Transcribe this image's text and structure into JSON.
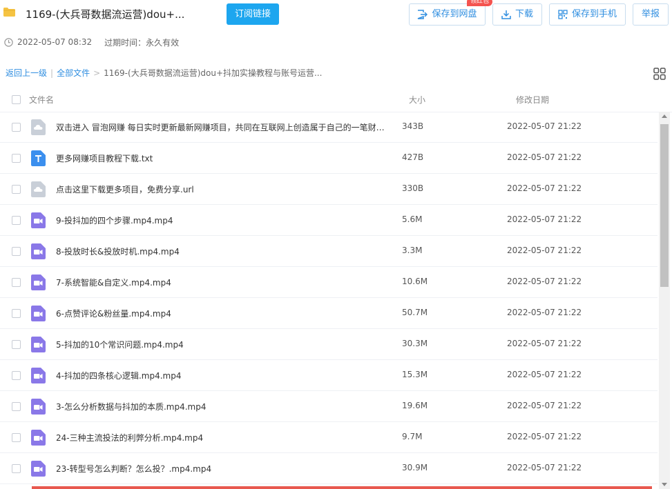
{
  "header": {
    "title": "1169-(大兵哥数据流运营)dou+...",
    "subscribe_label": "订阅链接",
    "save_to_disk_label": "保存到网盘",
    "badge_label": "领红包",
    "download_label": "下载",
    "save_to_phone_label": "保存到手机",
    "report_label": "举报"
  },
  "meta": {
    "created": "2022-05-07 08:32",
    "expire": "过期时间：永久有效"
  },
  "breadcrumb": {
    "back": "返回上一级",
    "divider": "|",
    "all": "全部文件",
    "sep": ">",
    "current": "1169-(大兵哥数据流运营)dou+抖加实操教程与账号运营..."
  },
  "columns": {
    "name": "文件名",
    "size": "大小",
    "date": "修改日期"
  },
  "colors": {
    "accent": "#1da6ef",
    "link": "#2f8ee0",
    "badge": "#f4534f",
    "video_icon": "#8a78e8",
    "txt_icon": "#3b8fee",
    "url_icon": "#c9cfd8",
    "folder": "#f5c342"
  },
  "files": [
    {
      "name": "双击进入 冒泡网赚 每日实时更新最新网赚项目，共同在互联网上创造属于自己的一笔财富！.url",
      "size": "343B",
      "date": "2022-05-07 21:22",
      "type": "url"
    },
    {
      "name": "更多网赚项目教程下载.txt",
      "size": "427B",
      "date": "2022-05-07 21:22",
      "type": "txt"
    },
    {
      "name": "点击这里下载更多项目，免费分享.url",
      "size": "330B",
      "date": "2022-05-07 21:22",
      "type": "url"
    },
    {
      "name": "9-投抖加的四个步骤.mp4.mp4",
      "size": "5.6M",
      "date": "2022-05-07 21:22",
      "type": "video"
    },
    {
      "name": "8-投放时长&投放时机.mp4.mp4",
      "size": "3.3M",
      "date": "2022-05-07 21:22",
      "type": "video"
    },
    {
      "name": "7-系统智能&自定义.mp4.mp4",
      "size": "10.6M",
      "date": "2022-05-07 21:22",
      "type": "video"
    },
    {
      "name": "6-点赞评论&粉丝量.mp4.mp4",
      "size": "50.7M",
      "date": "2022-05-07 21:22",
      "type": "video"
    },
    {
      "name": "5-抖加的10个常识问题.mp4.mp4",
      "size": "30.3M",
      "date": "2022-05-07 21:22",
      "type": "video"
    },
    {
      "name": "4-抖加的四条核心逻辑.mp4.mp4",
      "size": "15.3M",
      "date": "2022-05-07 21:22",
      "type": "video"
    },
    {
      "name": "3-怎么分析数据与抖加的本质.mp4.mp4",
      "size": "19.6M",
      "date": "2022-05-07 21:22",
      "type": "video"
    },
    {
      "name": "24-三种主流投法的利弊分析.mp4.mp4",
      "size": "9.7M",
      "date": "2022-05-07 21:22",
      "type": "video"
    },
    {
      "name": "23-转型号怎么判断？怎么投？.mp4.mp4",
      "size": "30.9M",
      "date": "2022-05-07 21:22",
      "type": "video"
    }
  ]
}
